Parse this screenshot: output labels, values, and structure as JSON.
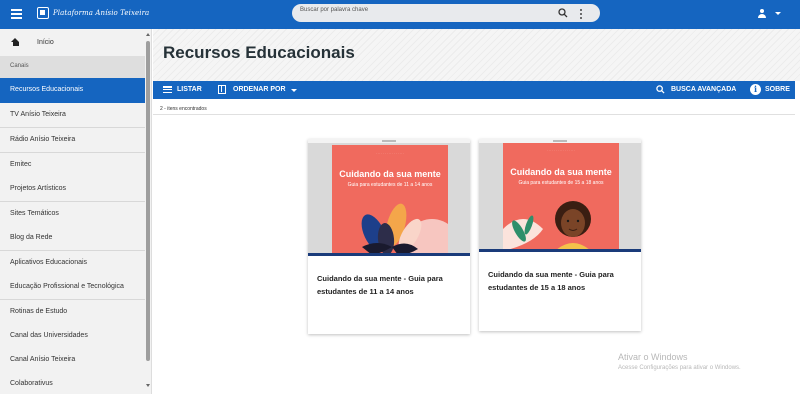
{
  "topbar": {
    "logo_text": "Plataforma Anísio Teixeira",
    "search_placeholder": "Buscar por palavra chave"
  },
  "sidebar": {
    "home_label": "Início",
    "section_label": "Canais",
    "items": [
      {
        "label": "Recursos Educacionais",
        "active": true
      },
      {
        "label": "TV Anísio Teixeira"
      },
      {
        "label": "Rádio Anísio Teixeira"
      },
      {
        "label": "Emitec"
      },
      {
        "label": "Projetos Artísticos"
      },
      {
        "label": "Sites Temáticos"
      },
      {
        "label": "Blog da Rede"
      },
      {
        "label": "Aplicativos Educacionais"
      },
      {
        "label": "Educação Profissional e Tecnológica"
      },
      {
        "label": "Rotinas de Estudo"
      },
      {
        "label": "Canal das Universidades"
      },
      {
        "label": "Canal Anísio Teixeira"
      },
      {
        "label": "Colaborativus"
      }
    ]
  },
  "main": {
    "title": "Recursos Educacionais",
    "toolbar": {
      "list_label": "LISTAR",
      "sort_label": "ORDENAR POR",
      "advanced_search_label": "BUSCA AVANÇADA",
      "about_label": "SOBRE"
    },
    "results_count": "2 - itens encontrados",
    "cards": [
      {
        "cover_title": "Cuidando da sua mente",
        "cover_subtitle": "Guia para estudantes de 11 a 14 anos",
        "title": "Cuidando da sua mente - Guia para estudantes de 11 a 14 anos"
      },
      {
        "cover_title": "Cuidando da sua mente",
        "cover_subtitle": "Guia para estudantes de 15 a 18 anos",
        "title": "Cuidando da sua mente - Guia para estudantes de 15 a 18 anos"
      }
    ]
  },
  "watermark": {
    "line1": "Ativar o Windows",
    "line2": "Acesse Configurações para ativar o Windows."
  },
  "colors": {
    "primary": "#1565c0",
    "cover": "#f06a5e",
    "active_item": "#1565c0"
  }
}
